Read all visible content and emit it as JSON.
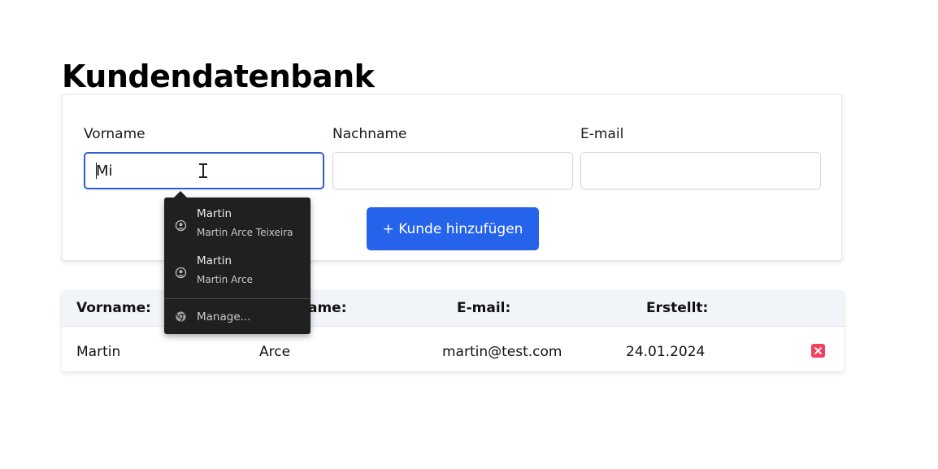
{
  "page": {
    "title": "Kundendatenbank"
  },
  "form": {
    "first_name": {
      "label": "Vorname",
      "value": "Mi",
      "placeholder": ""
    },
    "last_name": {
      "label": "Nachname",
      "value": "",
      "placeholder": ""
    },
    "email": {
      "label": "E-mail",
      "value": "",
      "placeholder": ""
    },
    "add_button_label": "+ Kunde hinzufügen"
  },
  "autocomplete": {
    "suggestions": [
      {
        "primary": "Martin",
        "secondary": "Martin Arce Teixeira",
        "icon": "user-circle-icon"
      },
      {
        "primary": "Martin",
        "secondary": "Martin Arce",
        "icon": "user-circle-icon"
      }
    ],
    "manage": {
      "label": "Manage...",
      "icon": "chrome-icon"
    }
  },
  "table": {
    "headers": [
      "Vorname:",
      "Nachname:",
      "E-mail:",
      "Erstellt:"
    ],
    "rows": [
      {
        "first_name": "Martin",
        "last_name": "Arce",
        "email": "martin@test.com",
        "created": "24.01.2024",
        "delete_icon": "delete-x-icon"
      }
    ]
  },
  "colors": {
    "accent": "#2563eb",
    "focus_border": "#2d5fd8",
    "delete": "#f43f5e",
    "dropdown_bg": "#202020",
    "table_header_bg": "#f1f4f8"
  }
}
